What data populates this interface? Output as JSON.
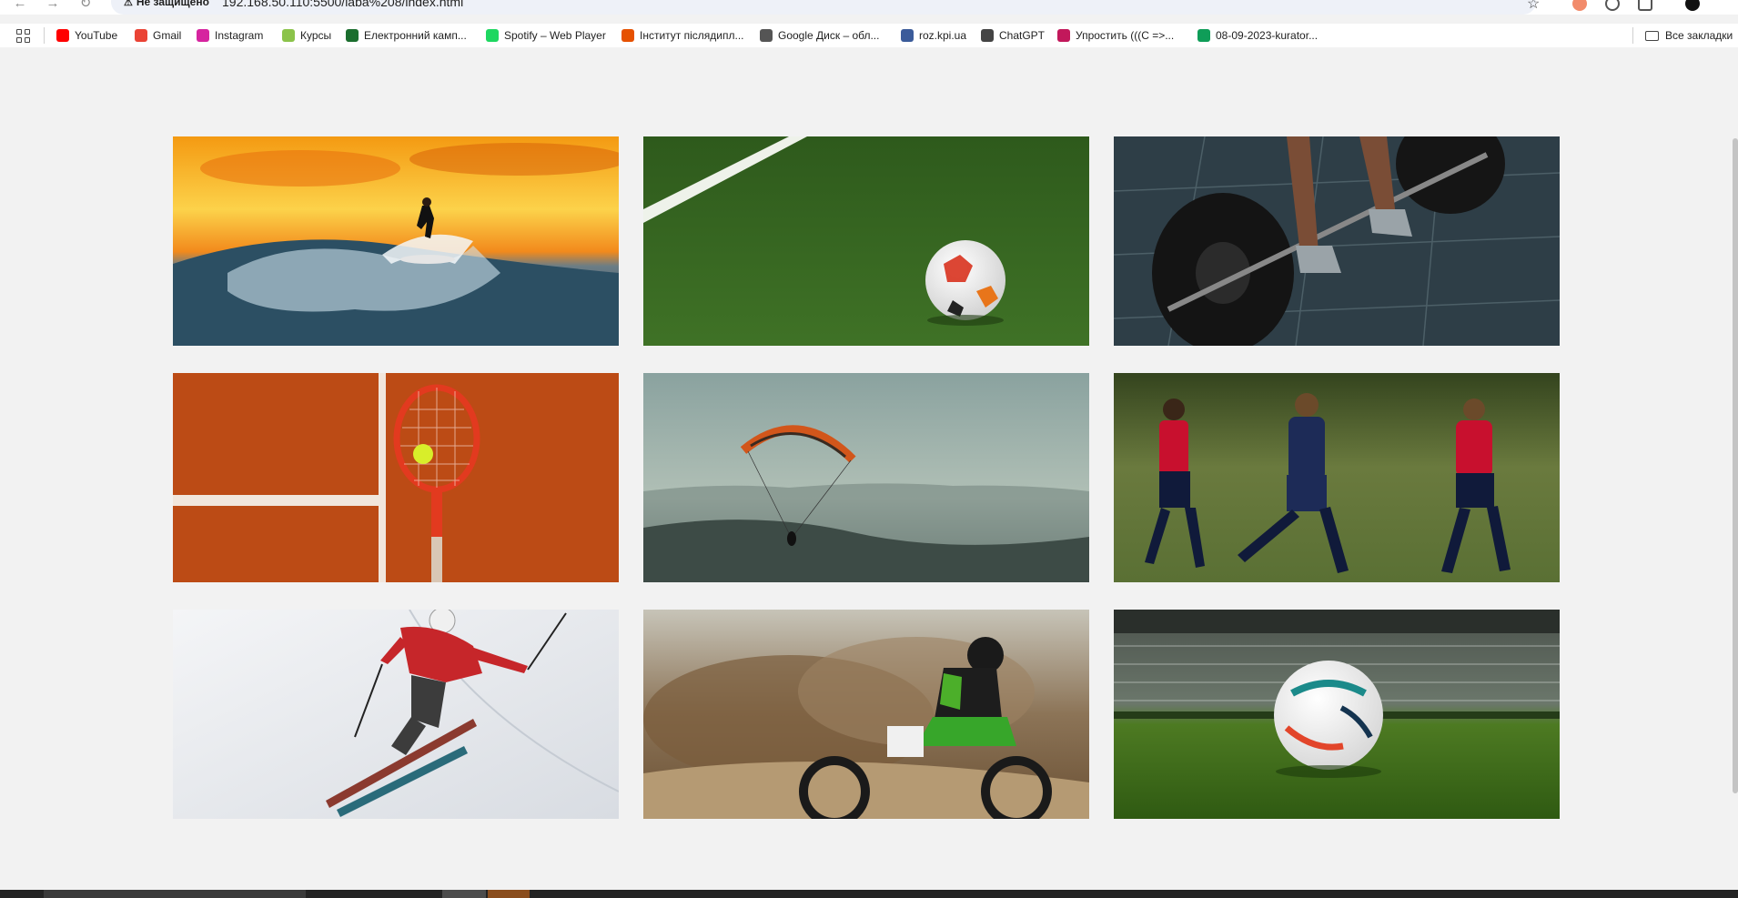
{
  "browser": {
    "security_label": "Не защищено",
    "url": "192.168.50.110:5500/laba%208/index.html"
  },
  "bookmarks": [
    {
      "label": "YouTube",
      "icon": "youtube-icon",
      "color": "#ff0000"
    },
    {
      "label": "Gmail",
      "icon": "gmail-icon",
      "color": "#ea4335"
    },
    {
      "label": "Instagram",
      "icon": "instagram-icon",
      "color": "#d6249f"
    },
    {
      "label": "Курсы",
      "icon": "courses-icon",
      "color": "#8bc34a"
    },
    {
      "label": "Електронний камп...",
      "icon": "campus-icon",
      "color": "#1b6e2e"
    },
    {
      "label": "Spotify – Web Player",
      "icon": "spotify-icon",
      "color": "#1ed760"
    },
    {
      "label": "Інститут післядипл...",
      "icon": "institute-icon",
      "color": "#e65100"
    },
    {
      "label": "Google Диск – обл...",
      "icon": "drive-icon",
      "color": "#555555"
    },
    {
      "label": "roz.kpi.ua",
      "icon": "roz-icon",
      "color": "#3b5b9a"
    },
    {
      "label": "ChatGPT",
      "icon": "chatgpt-icon",
      "color": "#444444"
    },
    {
      "label": "Упростить (((C =>...",
      "icon": "simplify-icon",
      "color": "#c2185b"
    },
    {
      "label": "08-09-2023-kurator...",
      "icon": "sheets-icon",
      "color": "#0f9d58"
    }
  ],
  "all_bookmarks_label": "Все закладки",
  "gallery": [
    {
      "icon": "surfer-photo-icon"
    },
    {
      "icon": "soccer-ball-on-grass-photo-icon"
    },
    {
      "icon": "barbell-deadlift-photo-icon"
    },
    {
      "icon": "tennis-racket-clay-court-photo-icon"
    },
    {
      "icon": "paraglider-photo-icon"
    },
    {
      "icon": "youth-football-match-photo-icon"
    },
    {
      "icon": "skier-photo-icon"
    },
    {
      "icon": "motocross-rider-photo-icon"
    },
    {
      "icon": "ball-in-stadium-photo-icon"
    }
  ]
}
